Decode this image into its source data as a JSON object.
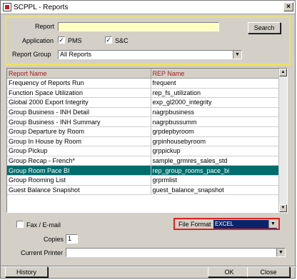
{
  "window": {
    "title": "SCPPL - Reports",
    "close_glyph": "×"
  },
  "filter": {
    "report_label": "Report",
    "report_value": "",
    "search_label": "Search",
    "application_label": "Application",
    "pms_label": "PMS",
    "pms_checked": "✓",
    "sc_label": "S&C",
    "sc_checked": "✓",
    "report_group_label": "Report Group",
    "report_group_value": "All Reports"
  },
  "table": {
    "headers": [
      "Report Name",
      "REP Name"
    ],
    "rows": [
      [
        "Frequency of Reports Run",
        "frequent"
      ],
      [
        "Function Space Utilization",
        "rep_fs_utilization"
      ],
      [
        "Global 2000 Export Integrity",
        "exp_gl2000_integrity"
      ],
      [
        "Group Business - INH Detail",
        "nagrpbusiness"
      ],
      [
        "Group Business - INH Summary",
        "nagrpbussumm"
      ],
      [
        "Group Departure by Room",
        "grpdepbyroom"
      ],
      [
        "Group In House by Room",
        "grpinhousebyroom"
      ],
      [
        "Group Pickup",
        "grppickup"
      ],
      [
        "Group Recap - French*",
        "sample_grmres_sales_std"
      ],
      [
        "Group Room Pace BI",
        "rep_group_rooms_pace_bi"
      ],
      [
        "Group Rooming List",
        "grprmlist"
      ],
      [
        "Guest Balance Snapshot",
        "guest_balance_snapshot"
      ]
    ],
    "selected_index": 9
  },
  "options": {
    "fax_email_label": "Fax / E-mail",
    "fax_checked": "",
    "file_format_label": "File Format",
    "file_format_value": "EXCEL",
    "copies_label": "Copies",
    "copies_value": "1",
    "current_printer_label": "Current Printer",
    "current_printer_value": ""
  },
  "footer": {
    "history_label": "History",
    "ok_label": "OK",
    "close_label": "Close"
  },
  "icons": {
    "dropdown": "▼",
    "scroll_up": "▲",
    "scroll_down": "▼"
  }
}
